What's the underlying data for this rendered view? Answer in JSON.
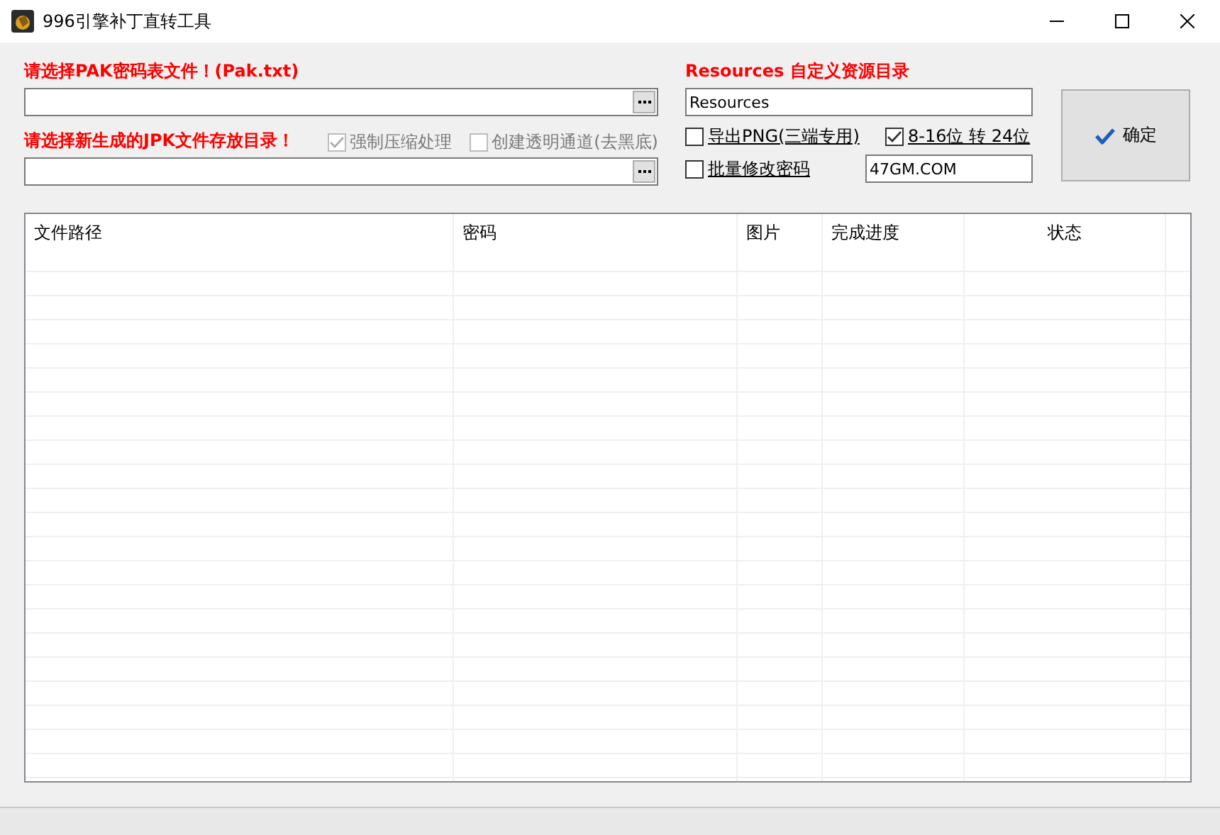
{
  "window": {
    "title": "996引擎补丁直转工具"
  },
  "pak_label": "请选择PAK密码表文件！(Pak.txt)",
  "pak_field": {
    "kind": "path"
  },
  "jpk_label": "请选择新生成的JPK文件存放目录！",
  "left_options": [
    {
      "label": "强制压缩处理",
      "checked": true,
      "disabled": true
    },
    {
      "label": "创建透明通道(去黑底)",
      "checked": false,
      "disabled": true
    }
  ],
  "jpk_field": {
    "kind": "path"
  },
  "resources_label": {
    "bold": "Resources",
    "rest": "自定义资源目录"
  },
  "resources_field": {
    "value": "Resources"
  },
  "right_options": [
    {
      "label": "导出PNG(三端专用)",
      "checked": false,
      "disabled": false
    },
    {
      "label": "8-16位 转 24位",
      "checked": true,
      "disabled": false
    },
    {
      "label": "批量修改密码",
      "checked": false,
      "disabled": false
    }
  ],
  "site_field": {
    "value": "47GM.COM"
  },
  "confirm_button": {
    "label": "确定"
  },
  "table": {
    "columns": [
      {
        "label": "文件路径"
      },
      {
        "label": "密码"
      },
      {
        "label": "图片"
      },
      {
        "label": "完成进度"
      },
      {
        "label": "状态"
      }
    ]
  }
}
